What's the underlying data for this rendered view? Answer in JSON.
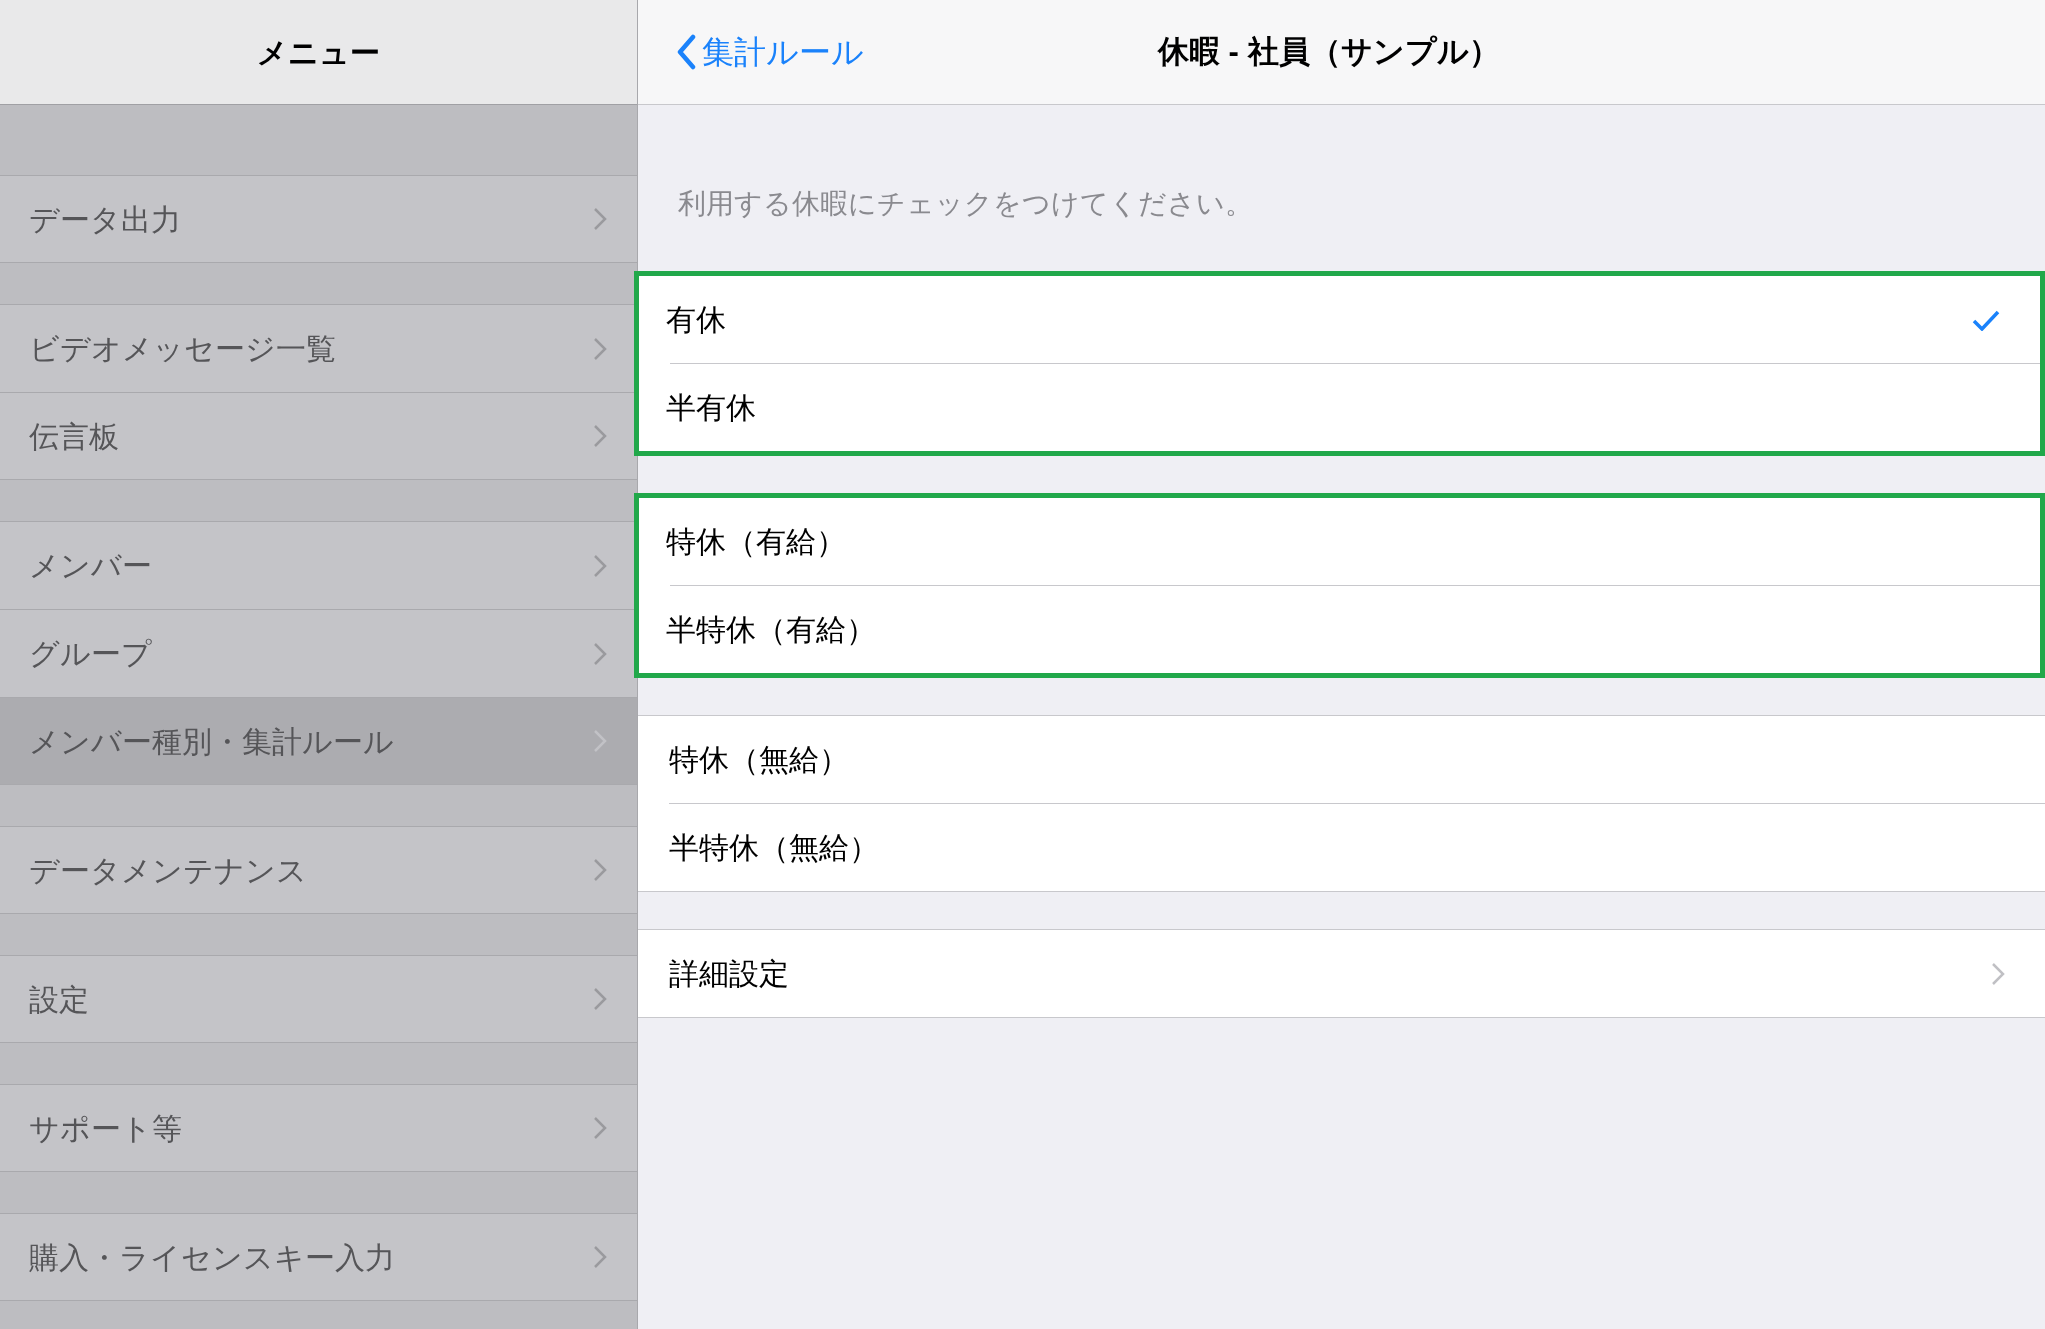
{
  "sidebar": {
    "title": "メニュー",
    "groups": [
      {
        "items": [
          {
            "label": "データ出力",
            "selected": false
          }
        ]
      },
      {
        "items": [
          {
            "label": "ビデオメッセージ一覧",
            "selected": false
          },
          {
            "label": "伝言板",
            "selected": false
          }
        ]
      },
      {
        "items": [
          {
            "label": "メンバー",
            "selected": false
          },
          {
            "label": "グループ",
            "selected": false
          },
          {
            "label": "メンバー種別・集計ルール",
            "selected": true
          }
        ]
      },
      {
        "items": [
          {
            "label": "データメンテナンス",
            "selected": false
          }
        ]
      },
      {
        "items": [
          {
            "label": "設定",
            "selected": false
          }
        ]
      },
      {
        "items": [
          {
            "label": "サポート等",
            "selected": false
          }
        ]
      },
      {
        "items": [
          {
            "label": "購入・ライセンスキー入力",
            "selected": false
          }
        ]
      }
    ]
  },
  "nav": {
    "back": "集計ルール",
    "title": "休暇 - 社員（サンプル）"
  },
  "note": "利用する休暇にチェックをつけてください。",
  "groups": [
    {
      "highlighted": true,
      "items": [
        {
          "kind": "check",
          "label": "有休",
          "checked": true
        },
        {
          "kind": "check",
          "label": "半有休",
          "checked": false
        }
      ]
    },
    {
      "highlighted": true,
      "items": [
        {
          "kind": "check",
          "label": "特休（有給）",
          "checked": false
        },
        {
          "kind": "check",
          "label": "半特休（有給）",
          "checked": false
        }
      ]
    },
    {
      "highlighted": false,
      "items": [
        {
          "kind": "check",
          "label": "特休（無給）",
          "checked": false
        },
        {
          "kind": "check",
          "label": "半特休（無給）",
          "checked": false
        }
      ]
    },
    {
      "highlighted": false,
      "items": [
        {
          "kind": "link",
          "label": "詳細設定"
        }
      ]
    }
  ]
}
